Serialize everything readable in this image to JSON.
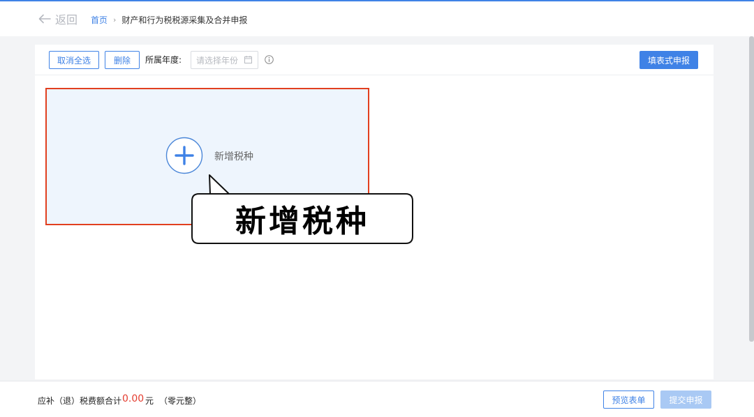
{
  "header": {
    "back_label": "返回",
    "breadcrumb": {
      "home": "首页",
      "separator": "›",
      "current": "财产和行为税税源采集及合并申报"
    }
  },
  "toolbar": {
    "deselect_all_label": "取消全选",
    "delete_label": "删除",
    "year_label": "所属年度:",
    "year_placeholder": "请选择年份",
    "fill_report_label": "填表式申报"
  },
  "add_card": {
    "label": "新增税种"
  },
  "callout": {
    "text": "新增税种"
  },
  "footer": {
    "total_label": "应补（退）税费额合计",
    "amount": "0.00",
    "unit": "元",
    "amount_words": "（零元整）",
    "preview_label": "预览表单",
    "submit_label": "提交申报"
  },
  "colors": {
    "accent": "#3f82e6",
    "highlight_border": "#e13f1f",
    "amount_red": "#e43d30",
    "add_card_bg": "#eef5fd",
    "submit_disabled": "#a9c9f4"
  },
  "icons": {
    "back": "arrow-left-icon",
    "calendar": "calendar-icon",
    "info": "info-circle-icon",
    "add": "plus-circle-icon"
  }
}
